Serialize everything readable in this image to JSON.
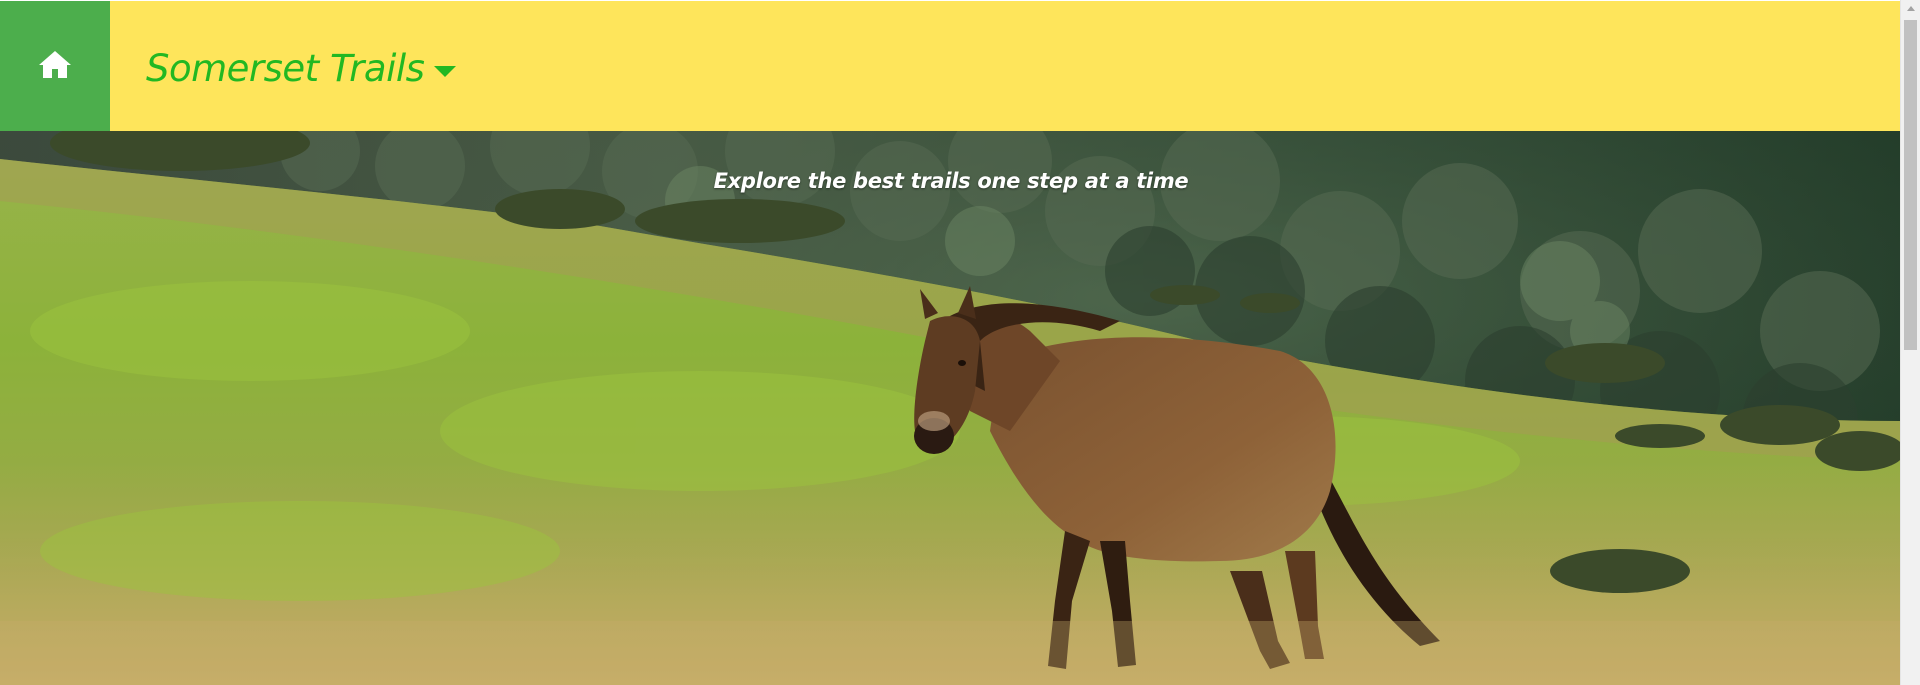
{
  "header": {
    "brand_title": "Somerset Trails",
    "home_icon": "home-icon",
    "dropdown_icon": "caret-down-icon"
  },
  "hero": {
    "tagline": "Explore the best trails one step at a time"
  },
  "colors": {
    "header_bg": "#fee55b",
    "home_bg": "#4cae4c",
    "brand_text": "#22b822",
    "tagline_text": "#ffffff"
  }
}
